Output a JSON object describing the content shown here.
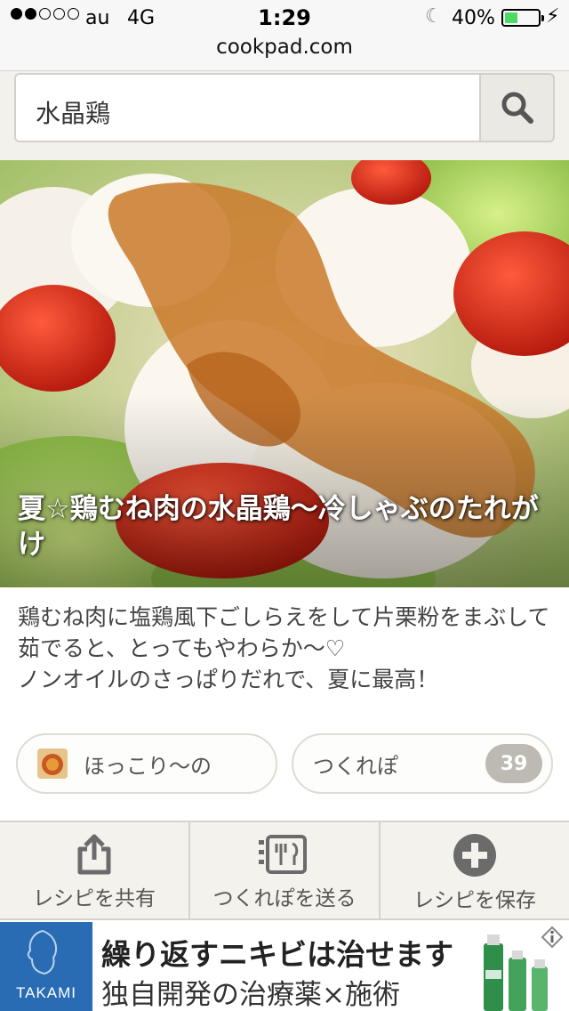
{
  "status_bar": {
    "carrier": "au",
    "network": "4G",
    "time": "1:29",
    "battery_percent": "40%",
    "battery_level": 0.4,
    "signal_bars_on": 2,
    "signal_bars_total": 5
  },
  "browser": {
    "url": "cookpad.com"
  },
  "search": {
    "value": "水晶鶏",
    "button_icon": "search-icon"
  },
  "recipe": {
    "title": "夏☆鶏むね肉の水晶鶏〜冷しゃぶのたれがけ",
    "description": "鶏むね肉に塩鶏風下ごしらえをして片栗粉をまぶして茹でると、とってもやわらか〜♡\nノンオイルのさっぱりだれで、夏に最高！",
    "author": "ほっこり〜の",
    "tsukurepo_label": "つくれぽ",
    "tsukurepo_count": "39"
  },
  "actions": [
    {
      "label": "レシピを共有",
      "icon": "share-icon"
    },
    {
      "label": "つくれぽを送る",
      "icon": "tsukurepo-send-icon"
    },
    {
      "label": "レシピを保存",
      "icon": "plus-circle-icon"
    }
  ],
  "ad": {
    "brand": "TAKAMI",
    "line1": "繰り返すニキビは治せます",
    "line2": "独自開発の治療薬×施術",
    "info_icon": "info-icon"
  },
  "colors": {
    "battery_fill": "#4cd964",
    "ad_brand_blue": "#2a6cb4",
    "badge_gray": "#bdbab3"
  }
}
